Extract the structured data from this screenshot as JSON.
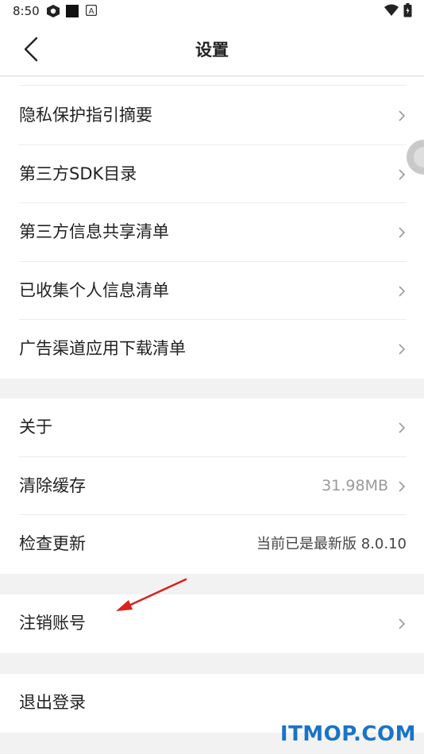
{
  "status_bar": {
    "time": "8:50",
    "icons": [
      "settings-gear-icon",
      "notification-square-icon",
      "app-a-icon",
      "wifi-icon",
      "battery-icon"
    ]
  },
  "header": {
    "title": "设置",
    "back_icon": "chevron-left-icon"
  },
  "groups": {
    "privacy": {
      "items": [
        {
          "label": "隐私保护指引摘要"
        },
        {
          "label": "第三方SDK目录"
        },
        {
          "label": "第三方信息共享清单"
        },
        {
          "label": "已收集个人信息清单"
        },
        {
          "label": "广告渠道应用下载清单"
        }
      ]
    },
    "about": {
      "items": [
        {
          "label": "关于"
        },
        {
          "label": "清除缓存",
          "value": "31.98MB"
        },
        {
          "label": "检查更新",
          "value": "当前已是最新版 8.0.10"
        }
      ]
    },
    "account": {
      "items": [
        {
          "label": "注销账号"
        }
      ]
    },
    "logout": {
      "items": [
        {
          "label": "退出登录"
        }
      ]
    }
  },
  "annotation": {
    "arrow_color": "#d9231d",
    "arrow_icon": "red-arrow-icon"
  },
  "watermark": {
    "text": "ITMOP.COM",
    "color": "#1a73c7"
  }
}
